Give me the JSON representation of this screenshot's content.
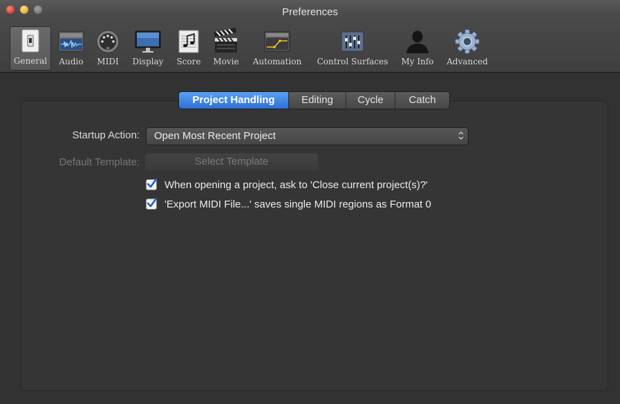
{
  "window": {
    "title": "Preferences"
  },
  "toolbar": {
    "items": [
      {
        "label": "General",
        "icon": "general-switch-icon",
        "selected": true
      },
      {
        "label": "Audio",
        "icon": "audio-waveform-icon"
      },
      {
        "label": "MIDI",
        "icon": "midi-connector-icon"
      },
      {
        "label": "Display",
        "icon": "display-monitor-icon"
      },
      {
        "label": "Score",
        "icon": "score-notes-icon"
      },
      {
        "label": "Movie",
        "icon": "movie-clapper-icon"
      },
      {
        "label": "Automation",
        "icon": "automation-curve-icon"
      },
      {
        "label": "Control Surfaces",
        "icon": "control-surface-faders-icon"
      },
      {
        "label": "My Info",
        "icon": "user-silhouette-icon"
      },
      {
        "label": "Advanced",
        "icon": "gear-icon"
      }
    ]
  },
  "tabs": [
    {
      "label": "Project Handling",
      "active": true
    },
    {
      "label": "Editing"
    },
    {
      "label": "Cycle"
    },
    {
      "label": "Catch"
    }
  ],
  "form": {
    "startup_action_label": "Startup Action:",
    "startup_action_value": "Open Most Recent Project",
    "default_template_label": "Default Template:",
    "select_template_label": "Select Template",
    "checkboxes": [
      {
        "label": "When opening a project, ask to 'Close current project(s)?'",
        "checked": true
      },
      {
        "label": "'Export MIDI File...' saves single MIDI regions as Format 0",
        "checked": true
      }
    ]
  },
  "colors": {
    "accent": "#2d6fd6",
    "window_bg": "#323232",
    "label_text": "#dcdcdc",
    "disabled_text": "#7a7a7a"
  }
}
